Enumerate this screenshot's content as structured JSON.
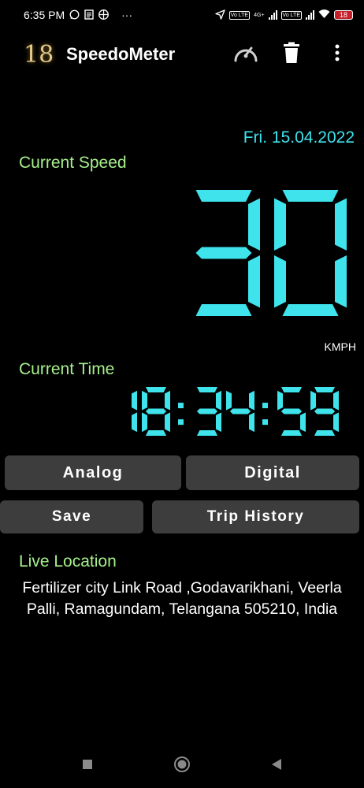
{
  "status_bar": {
    "time": "6:35 PM",
    "more": "···",
    "tag_1": "Vo LTE",
    "network": "4G+",
    "tag_2": "Vo LTE",
    "battery": "18"
  },
  "app_bar": {
    "logo_text": "18",
    "title": "SpeedoMeter",
    "icons": [
      "speedometer-icon",
      "trash-icon",
      "more-vert-icon"
    ]
  },
  "date": "Fri. 15.04.2022",
  "speed": {
    "label": "Current Speed",
    "value": "30",
    "unit": "KMPH"
  },
  "time_panel": {
    "label": "Current Time",
    "value": "18:34:59"
  },
  "buttons": {
    "analog": "Analog",
    "digital": "Digital",
    "save": "Save",
    "trip_history": "Trip History"
  },
  "location": {
    "label": "Live Location",
    "address": "Fertilizer city Link Road ,Godavarikhani, Veerla Palli, Ramagundam, Telangana 505210, India"
  },
  "colors": {
    "cyan": "#3ee3ec",
    "green_label": "#a6f08c",
    "button_bg": "#3d3d3d"
  }
}
